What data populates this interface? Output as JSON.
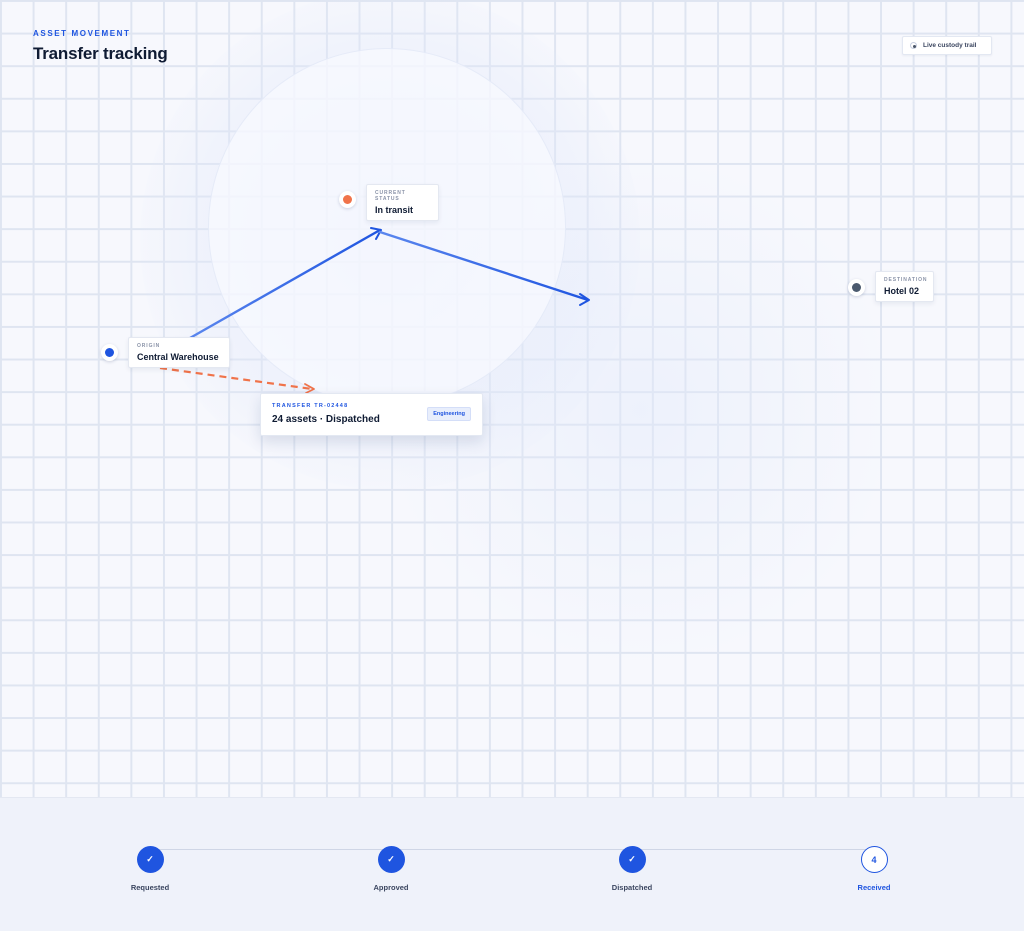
{
  "header": {
    "eyebrow": "ASSET MOVEMENT",
    "title": "Transfer tracking"
  },
  "legend": {
    "live_label": "Live custody trail"
  },
  "nodes": {
    "origin": {
      "caption": "ORIGIN",
      "name": "Central Warehouse",
      "color": "#1f55e0"
    },
    "current": {
      "caption": "CURRENT STATUS",
      "name": "In transit",
      "color": "#f0734a"
    },
    "destination": {
      "caption": "DESTINATION",
      "name": "Hotel 02",
      "color": "#4b5a6e"
    }
  },
  "transfer": {
    "id_label": "TRANSFER TR-02448",
    "summary": "24 assets · Dispatched",
    "department": "Engineering"
  },
  "colors": {
    "accent": "#1f55e0",
    "route_dashed": "#f0734a"
  },
  "steps": [
    {
      "label": "Requested",
      "state": "done",
      "mark": "✓"
    },
    {
      "label": "Approved",
      "state": "done",
      "mark": "✓"
    },
    {
      "label": "Dispatched",
      "state": "done",
      "mark": "✓"
    },
    {
      "label": "Received",
      "state": "current",
      "mark": "4"
    }
  ]
}
